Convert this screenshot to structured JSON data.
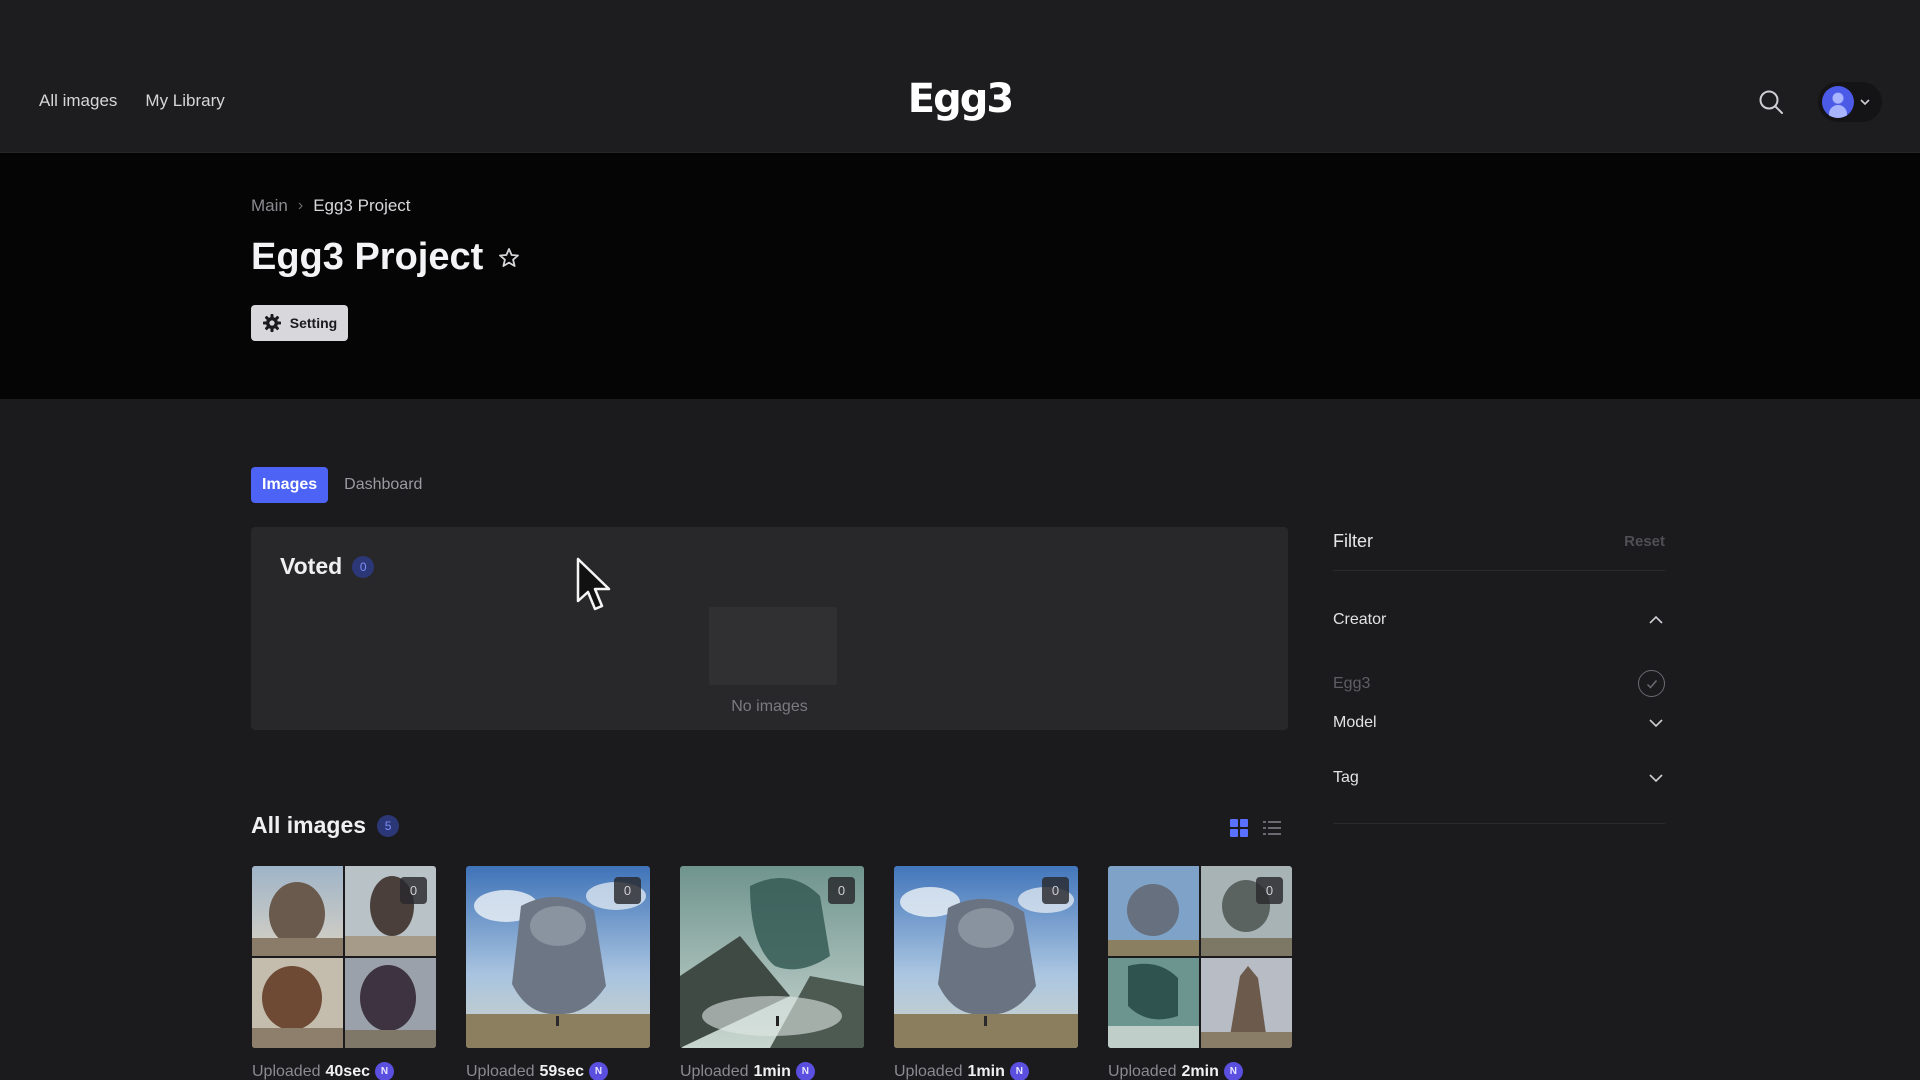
{
  "nav": {
    "links": [
      "All images",
      "My Library"
    ],
    "logo_text": "Egg3"
  },
  "breadcrumb": {
    "main": "Main",
    "separator": "›",
    "current": "Egg3 Project"
  },
  "page": {
    "title": "Egg3 Project",
    "setting_label": "Setting"
  },
  "tabs": [
    "Images",
    "Dashboard"
  ],
  "voted": {
    "title": "Voted",
    "count": "0",
    "empty_text": "No images"
  },
  "all_images": {
    "title": "All images",
    "count": "5"
  },
  "filter": {
    "title": "Filter",
    "reset": "Reset",
    "sections": {
      "creator": "Creator",
      "creator_option": "Egg3",
      "model": "Model",
      "tag": "Tag"
    }
  },
  "images": [
    {
      "votes": "0",
      "uploaded_label": "Uploaded",
      "time": "40sec",
      "badge": "N",
      "kind": "grid-4"
    },
    {
      "votes": "0",
      "uploaded_label": "Uploaded",
      "time": "59sec",
      "badge": "N",
      "kind": "stone-golem"
    },
    {
      "votes": "0",
      "uploaded_label": "Uploaded",
      "time": "1min",
      "badge": "N",
      "kind": "mist-giant"
    },
    {
      "votes": "0",
      "uploaded_label": "Uploaded",
      "time": "1min",
      "badge": "N",
      "kind": "stone-golem"
    },
    {
      "votes": "0",
      "uploaded_label": "Uploaded",
      "time": "2min",
      "badge": "N",
      "kind": "grid-4-mixed"
    }
  ],
  "colors": {
    "accent": "#4d63f5",
    "badge_purple": "#5b4fe0",
    "background": "#1b1b1d",
    "hero": "#050506",
    "card": "#28282b"
  },
  "icons": [
    "search-icon",
    "avatar",
    "chevron-down-icon",
    "star-icon",
    "gear-icon",
    "chevron-up-icon",
    "check-circle-icon",
    "grid-view-icon",
    "list-view-icon",
    "cursor-arrow-icon"
  ]
}
